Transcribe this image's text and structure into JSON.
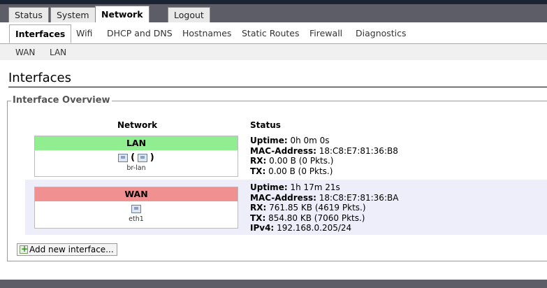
{
  "tabs": [
    "Status",
    "System",
    "Network",
    "Logout"
  ],
  "subtabs": [
    "Interfaces",
    "Wifi",
    "DHCP and DNS",
    "Hostnames",
    "Static Routes",
    "Firewall",
    "Diagnostics"
  ],
  "subsubtabs": [
    "WAN",
    "LAN"
  ],
  "page_title": "Interfaces",
  "overview": {
    "legend": "Interface Overview",
    "col_network": "Network",
    "col_status": "Status",
    "add_label": "Add new interface...",
    "labels": {
      "uptime": "Uptime:",
      "mac": "MAC-Address:",
      "rx": "RX:",
      "tx": "TX:",
      "ipv4": "IPv4:"
    },
    "interfaces": [
      {
        "name": "LAN",
        "color": "#90ee90",
        "device": "br-lan",
        "uptime": "0h 0m 0s",
        "mac": "18:C8:E7:81:36:B8",
        "rx": "0.00 B (0 Pkts.)",
        "tx": "0.00 B (0 Pkts.)"
      },
      {
        "name": "WAN",
        "color": "#f09090",
        "device": "eth1",
        "uptime": "1h 17m 21s",
        "mac": "18:C8:E7:81:36:BA",
        "rx": "761.85 KB (4619 Pkts.)",
        "tx": "854.80 KB (7060 Pkts.)",
        "ipv4": "192.168.0.205/24"
      }
    ]
  },
  "icons": {
    "bridge": "ethernet-icon",
    "port": "ethernet-port-icon",
    "add": "add-icon"
  }
}
